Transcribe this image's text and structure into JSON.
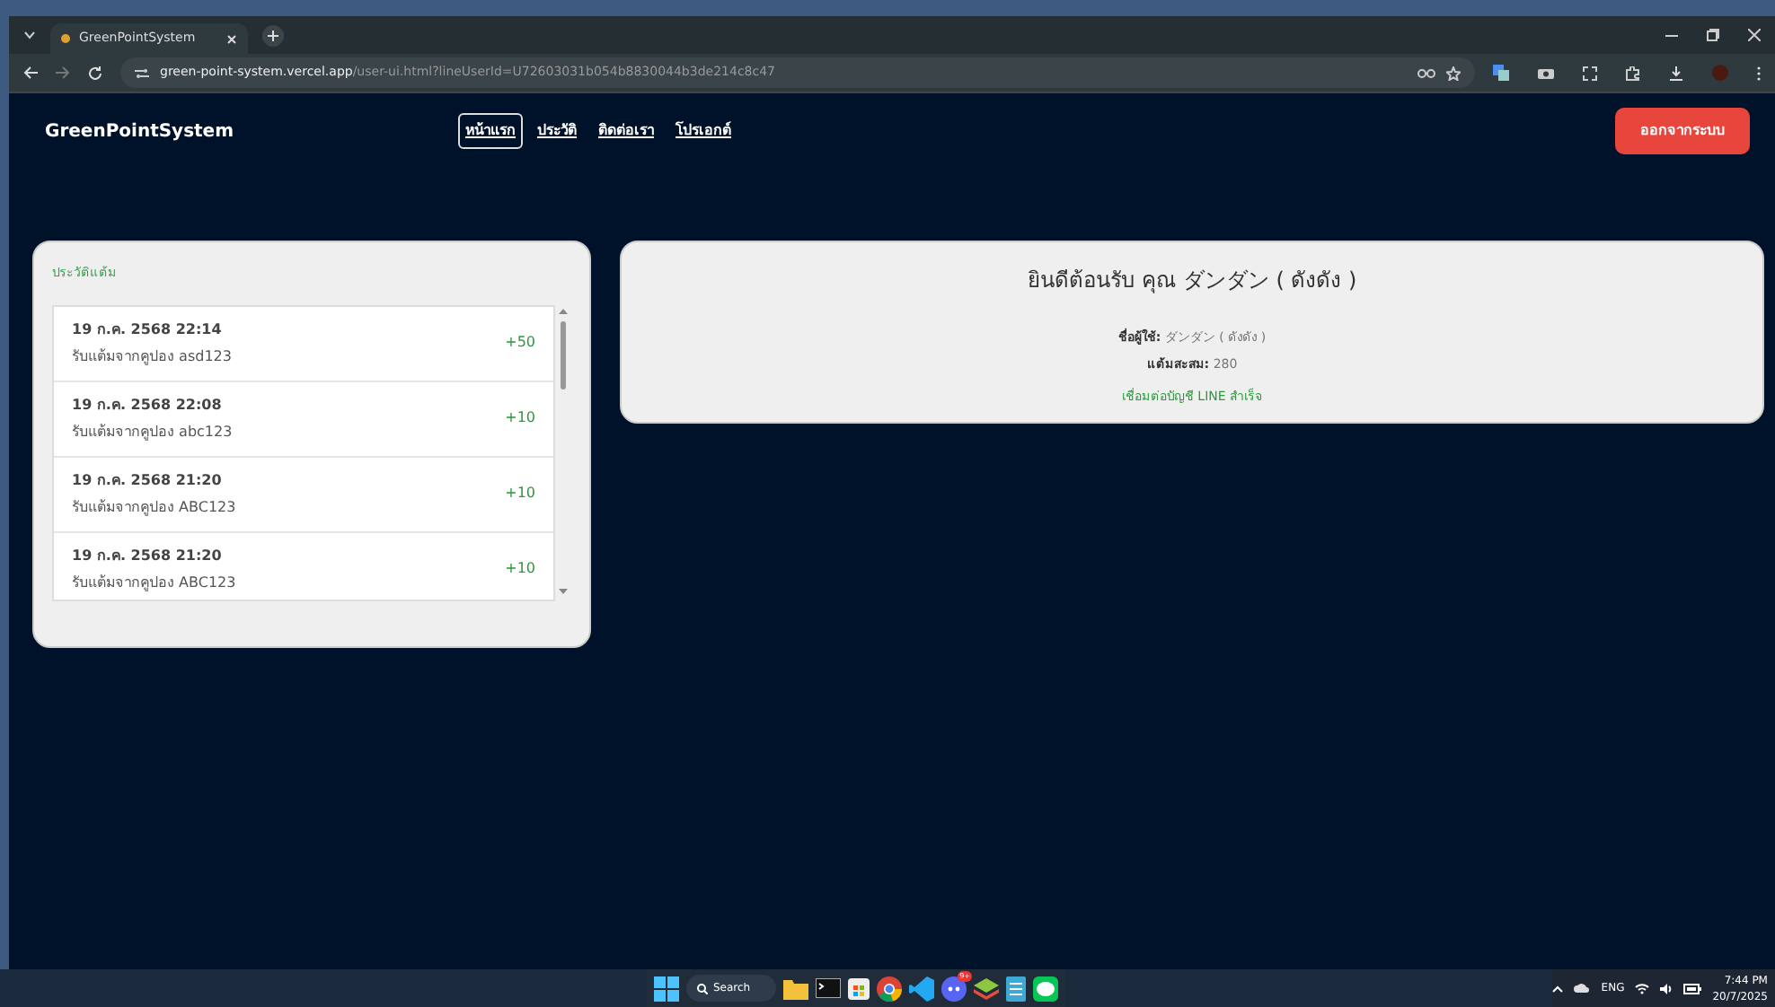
{
  "browser": {
    "tab_title": "GreenPointSystem",
    "url_host": "green-point-system.vercel.app",
    "url_path": "/user-ui.html?lineUserId=U72603031b054b8830044b3de214c8c47"
  },
  "navbar": {
    "brand": "GreenPointSystem",
    "links": [
      {
        "label": "หน้าแรก",
        "selected": true
      },
      {
        "label": "ประวัติ",
        "selected": false
      },
      {
        "label": "ติดต่อเรา",
        "selected": false
      },
      {
        "label": "โปรเอกต์",
        "selected": false
      }
    ],
    "logout_button": "ออกจากระบบ"
  },
  "history": {
    "title": "ประวัติแต้ม",
    "items": [
      {
        "date": "19 ก.ค. 2568 22:14",
        "description": "รับแต้มจากคูปอง asd123",
        "points": "+50"
      },
      {
        "date": "19 ก.ค. 2568 22:08",
        "description": "รับแต้มจากคูปอง abc123",
        "points": "+10"
      },
      {
        "date": "19 ก.ค. 2568 21:20",
        "description": "รับแต้มจากคูปอง ABC123",
        "points": "+10"
      },
      {
        "date": "19 ก.ค. 2568 21:20",
        "description": "รับแต้มจากคูปอง ABC123",
        "points": "+10"
      }
    ]
  },
  "welcome": {
    "heading": "ยินดีต้อนรับ คุณ ダンダン ( ดังดัง )",
    "username_label": "ชื่อผู้ใช้:",
    "username_value": "ダンダン ( ดังดัง )",
    "points_label": "แต้มสะสม:",
    "points_value": "280",
    "line_status": "เชื่อมต่อบัญชี LINE สำเร็จ"
  },
  "taskbar": {
    "search": "Search",
    "notification_badge": "9+",
    "language": "ENG",
    "time": "7:44 PM",
    "date": "20/7/2025"
  }
}
